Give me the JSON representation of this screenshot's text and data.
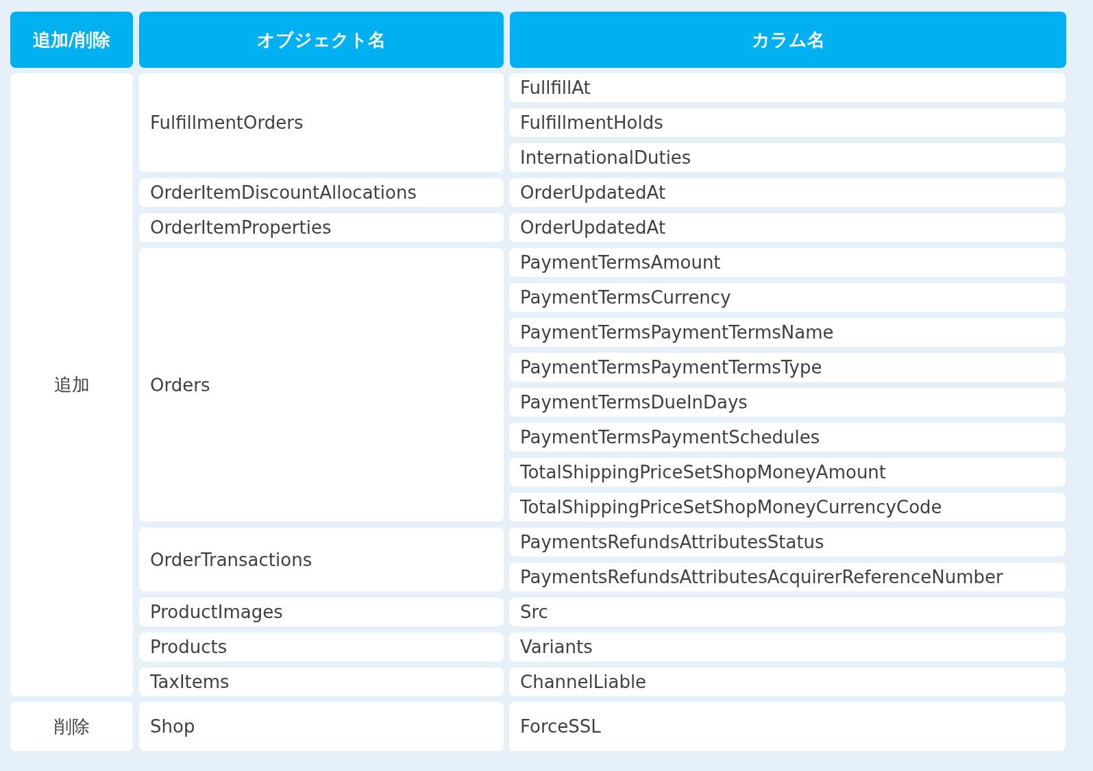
{
  "table": {
    "columns": [
      "追加/削除",
      "オブジェクト名",
      "カラム名"
    ],
    "groups": [
      {
        "action": "追加",
        "objects": [
          {
            "name": "FulfillmentOrders",
            "columns": [
              "FullfillAt",
              "FulfillmentHolds",
              "InternationalDuties"
            ]
          },
          {
            "name": "OrderItemDiscountAllocations",
            "columns": [
              "OrderUpdatedAt"
            ]
          },
          {
            "name": "OrderItemProperties",
            "columns": [
              "OrderUpdatedAt"
            ]
          },
          {
            "name": "Orders",
            "columns": [
              "PaymentTermsAmount",
              "PaymentTermsCurrency",
              "PaymentTermsPaymentTermsName",
              "PaymentTermsPaymentTermsType",
              "PaymentTermsDueInDays",
              "PaymentTermsPaymentSchedules",
              "TotalShippingPriceSetShopMoneyAmount",
              "TotalShippingPriceSetShopMoneyCurrencyCode"
            ]
          },
          {
            "name": "OrderTransactions",
            "columns": [
              "PaymentsRefundsAttributesStatus",
              "PaymentsRefundsAttributesAcquirerReferenceNumber"
            ]
          },
          {
            "name": "ProductImages",
            "columns": [
              "Src"
            ]
          },
          {
            "name": "Products",
            "columns": [
              "Variants"
            ]
          },
          {
            "name": "TaxItems",
            "columns": [
              "ChannelLiable"
            ]
          }
        ]
      },
      {
        "action": "削除",
        "objects": [
          {
            "name": "Shop",
            "columns": [
              "ForceSSL"
            ]
          }
        ]
      }
    ]
  }
}
